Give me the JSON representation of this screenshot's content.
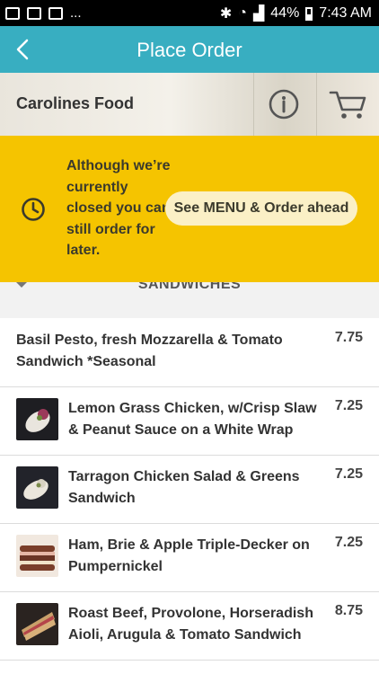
{
  "status_bar": {
    "left_extra": "...",
    "battery": "44%",
    "time": "7:43 AM"
  },
  "header": {
    "title": "Place Order"
  },
  "store": {
    "name": "Carolines Food"
  },
  "banner": {
    "message": "Although we’re currently closed you can still order for later.",
    "button_label": "See MENU & Order ahead"
  },
  "section": {
    "label": "SANDWICHES"
  },
  "menu": [
    {
      "name": "Basil Pesto, fresh Mozzarella & Tomato Sandwich *Seasonal",
      "price": "7.75",
      "thumb": "none"
    },
    {
      "name": "Lemon Grass Chicken, w/Crisp Slaw & Peanut Sauce on a White Wrap",
      "price": "7.25",
      "thumb": "wrap"
    },
    {
      "name": "Tarragon Chicken Salad & Greens Sandwich",
      "price": "7.25",
      "thumb": "wrap"
    },
    {
      "name": "Ham, Brie & Apple Triple-Decker on Pumpernickel",
      "price": "7.25",
      "thumb": "sandwich"
    },
    {
      "name": "Roast Beef, Provolone, Horseradish Aioli, Arugula & Tomato Sandwich",
      "price": "8.75",
      "thumb": "sandwich"
    }
  ],
  "colors": {
    "accent": "#38aec1",
    "banner": "#f5c400",
    "pill": "#fbf0c6"
  }
}
